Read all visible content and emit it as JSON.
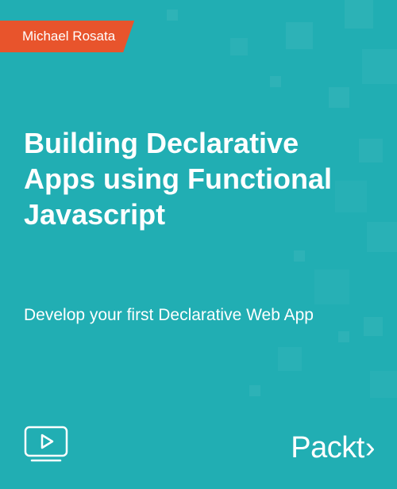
{
  "author": "Michael Rosata",
  "title": "Building Declarative Apps using Functional Javascript",
  "subtitle": "Develop your first Declarative Web App",
  "publisher": {
    "name": "Packt",
    "suffix": "›"
  },
  "colors": {
    "background": "#21aeb3",
    "authorBadge": "#e8542c",
    "text": "#ffffff"
  }
}
